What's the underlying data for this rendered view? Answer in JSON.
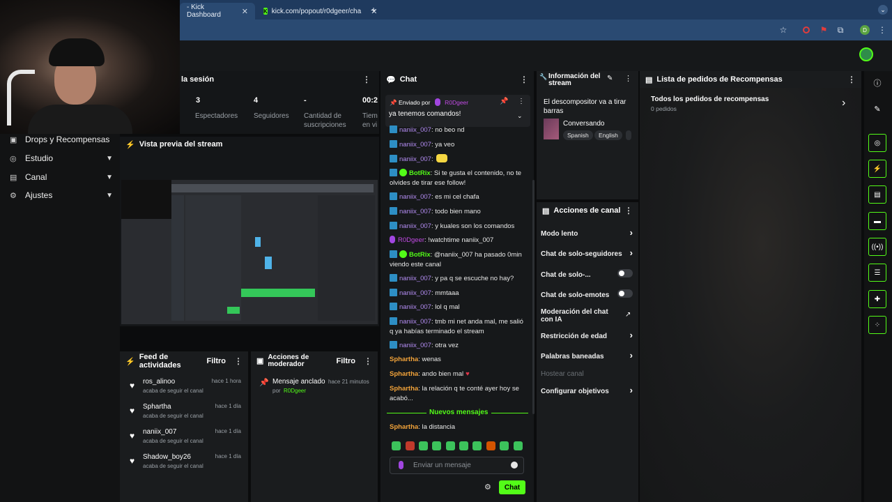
{
  "browser": {
    "tabs": [
      {
        "label": "- Kick Dashboard",
        "close": "✕"
      },
      {
        "label": "kick.com/popout/r0dgeer/cha",
        "close": "✕"
      }
    ],
    "new_tab": "+"
  },
  "sidebar": {
    "items": [
      {
        "label": "Drops y Recompensas",
        "icon": "gift-icon"
      },
      {
        "label": "Estudio",
        "icon": "studio-icon"
      },
      {
        "label": "Canal",
        "icon": "channel-icon"
      },
      {
        "label": "Ajustes",
        "icon": "gear-icon"
      }
    ]
  },
  "session": {
    "title": "la sesión",
    "stats": [
      {
        "value": "3",
        "label": "Espectadores"
      },
      {
        "value": "4",
        "label": "Seguidores"
      },
      {
        "value": "-",
        "label": "Cantidad de suscripciones"
      },
      {
        "value": "00:2",
        "label": "Tiem en vi"
      }
    ]
  },
  "preview": {
    "title": "Vista previa del stream"
  },
  "feed": {
    "title": "Feed de actividades",
    "filter": "Filtro",
    "items": [
      {
        "user": "ros_alinoo",
        "time": "hace 1 hora",
        "sub": "acaba de seguir el canal"
      },
      {
        "user": "Sphartha",
        "time": "hace 1 día",
        "sub": "acaba de seguir el canal"
      },
      {
        "user": "naniix_007",
        "time": "hace 1 día",
        "sub": "acaba de seguir el canal"
      },
      {
        "user": "Shadow_boy26",
        "time": "hace 1 día",
        "sub": "acaba de seguir el canal"
      }
    ]
  },
  "modactions": {
    "title": "Acciones de moderador",
    "filter": "Filtro",
    "item_label": "Mensaje anclado",
    "item_time": "hace 21 minutos",
    "item_by": "por",
    "item_user": "R0Dgeer"
  },
  "chat": {
    "title": "Chat",
    "pinned_label": "Enviado por",
    "pinned_user": "R0Dgeer",
    "pinned_text": "ya tenemos comandos!",
    "messages": [
      {
        "user": "naniix_007",
        "text": ": no beo nd"
      },
      {
        "user": "naniix_007",
        "text": ": ya veo"
      },
      {
        "user": "naniix_007",
        "text": ":"
      },
      {
        "user": "BotRix",
        "text": ": Si te gusta el contenido, no te olvides de tirar ese follow!"
      },
      {
        "user": "naniix_007",
        "text": ": es mi cel chafa"
      },
      {
        "user": "naniix_007",
        "text": ": todo bien mano"
      },
      {
        "user": "naniix_007",
        "text": ": y kuales son los comandos"
      },
      {
        "user": "R0Dgeer",
        "text": ": !watchtime naniix_007"
      },
      {
        "user": "BotRix",
        "text": ": @naniix_007 ha pasado 0min viendo este canal"
      },
      {
        "user": "naniix_007",
        "text": ": y pa q se escuche no hay?"
      },
      {
        "user": "naniix_007",
        "text": ": mmtaaa"
      },
      {
        "user": "naniix_007",
        "text": ": lol q mal"
      },
      {
        "user": "naniix_007",
        "text": ": tmb mi net anda mal, me salió q ya habías terminado el stream"
      },
      {
        "user": "naniix_007",
        "text": ": otra vez"
      },
      {
        "user": "Sphartha",
        "text": ": wenas"
      },
      {
        "user": "Sphartha",
        "text": ": ando bien mal"
      },
      {
        "user": "Sphartha",
        "text": ": la relación q te conté ayer hoy se acabó..."
      },
      {
        "user": "Sphartha",
        "text": ": la distancia"
      }
    ],
    "new_messages": "Nuevos mensajes",
    "input_placeholder": "Enviar un mensaje",
    "send_label": "Chat"
  },
  "info": {
    "title": "Información del stream",
    "stream_title": "El descompositor va a tirar barras",
    "category": "Conversando",
    "tags": [
      "Spanish",
      "English"
    ]
  },
  "channel_actions": {
    "title": "Acciones de canal",
    "items": [
      {
        "label": "Modo lento",
        "control": "chevron"
      },
      {
        "label": "Chat de solo-seguidores",
        "control": "chevron"
      },
      {
        "label": "Chat de solo-...",
        "control": "toggle"
      },
      {
        "label": "Chat de solo-emotes",
        "control": "toggle"
      },
      {
        "label": "Moderación del chat con IA",
        "control": "external"
      },
      {
        "label": "Restricción de edad",
        "control": "chevron"
      },
      {
        "label": "Palabras baneadas",
        "control": "chevron"
      },
      {
        "label": "Hostear canal",
        "control": "none"
      },
      {
        "label": "Configurar objetivos",
        "control": "chevron"
      }
    ]
  },
  "rewards": {
    "title": "Lista de pedidos de Recompensas",
    "all_label": "Todos los pedidos de recompensas",
    "count_label": "0 pedidos"
  },
  "colors": {
    "accent": "#53fc18",
    "panel": "#1a1c1e",
    "chrome": "#2a4a72"
  }
}
